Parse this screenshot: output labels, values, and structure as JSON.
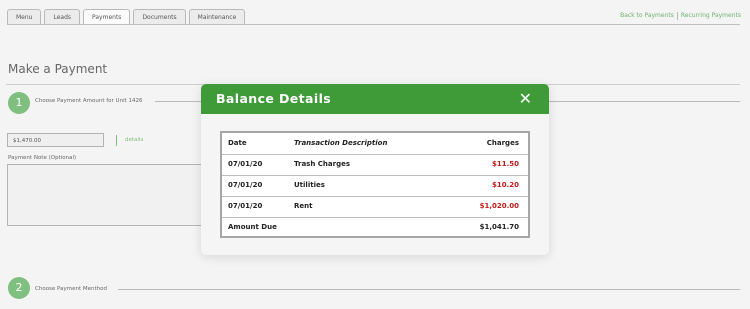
{
  "tabs": [
    "Menu",
    "Leads",
    "Payments",
    "Documents",
    "Maintenance"
  ],
  "active_tab": "Payments",
  "top_links": {
    "back": "Back to Payments",
    "recurring": "Recurring Payments"
  },
  "page_title": "Make a Payment",
  "step1": {
    "number": "1",
    "label": "Choose Payment Amount for Unit 1426"
  },
  "amount_value": "$1,470.00",
  "details_link": "details",
  "payment_note_label": "Payment Note (Optional)",
  "step2": {
    "number": "2",
    "label": "Choose Payment Menthod"
  },
  "modal": {
    "title": "Balance Details",
    "close": "✕",
    "headers": {
      "date": "Date",
      "description": "Transaction Description",
      "charges": "Charges"
    },
    "rows": [
      {
        "date": "07/01/20",
        "description": "Trash Charges",
        "charge": "$11.50"
      },
      {
        "date": "07/01/20",
        "description": "Utilities",
        "charge": "$10.20"
      },
      {
        "date": "07/01/20",
        "description": "Rent",
        "charge": "$1,020.00"
      }
    ],
    "total": {
      "label": "Amount Due",
      "value": "$1,041.70"
    }
  },
  "colors": {
    "accent": "#3f9a38",
    "step": "#7fbf7f",
    "charge": "#c41a1a"
  }
}
